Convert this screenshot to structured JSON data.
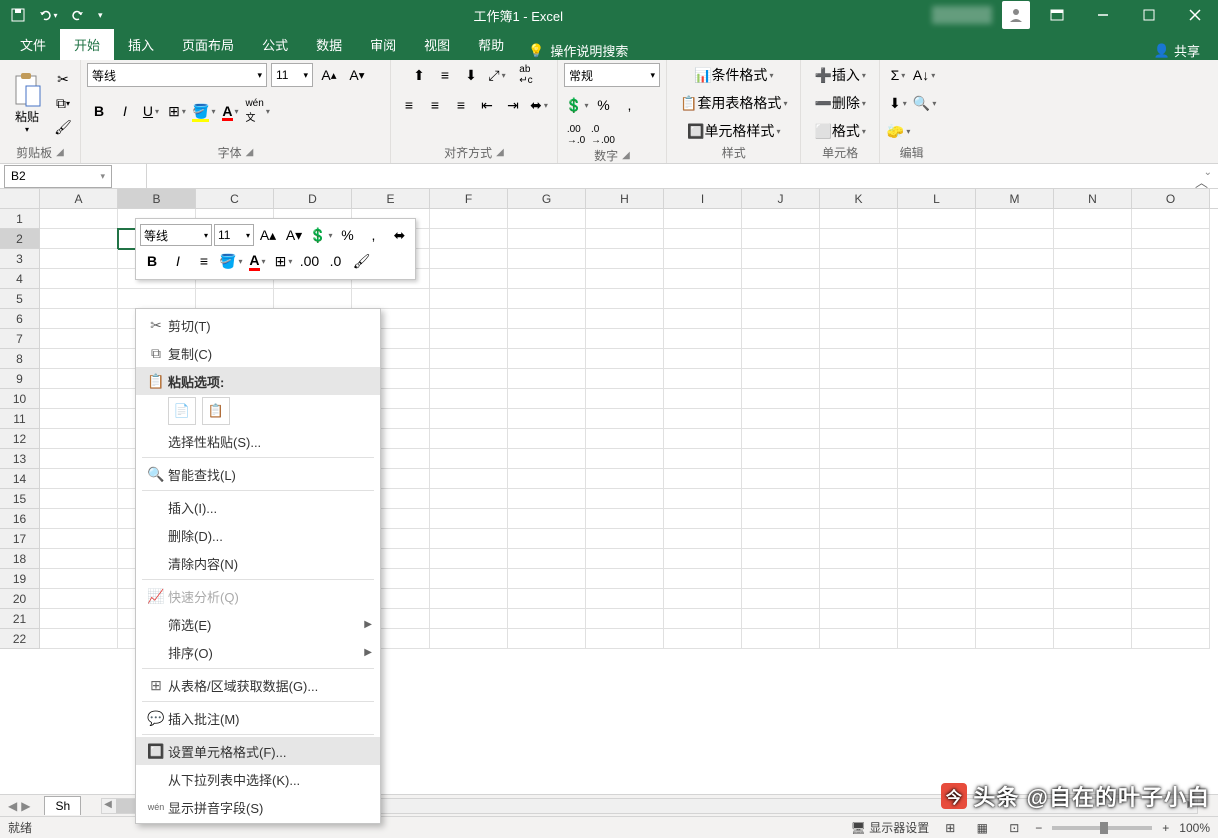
{
  "title": "工作簿1 - Excel",
  "qat": {
    "save": "💾",
    "undo": "↶",
    "redo": "↷"
  },
  "tabs": {
    "file": "文件",
    "home": "开始",
    "insert": "插入",
    "layout": "页面布局",
    "formulas": "公式",
    "data": "数据",
    "review": "审阅",
    "view": "视图",
    "help": "帮助",
    "tellme": "操作说明搜索",
    "share": "共享"
  },
  "ribbon": {
    "clipboard": {
      "label": "剪贴板",
      "paste": "粘贴"
    },
    "font": {
      "label": "字体",
      "name": "等线",
      "size": "11"
    },
    "align": {
      "label": "对齐方式"
    },
    "number": {
      "label": "数字",
      "format": "常规"
    },
    "styles": {
      "label": "样式",
      "cond": "条件格式",
      "table": "套用表格格式",
      "cell": "单元格样式"
    },
    "cells": {
      "label": "单元格",
      "insert": "插入",
      "delete": "删除",
      "format": "格式"
    },
    "editing": {
      "label": "编辑"
    }
  },
  "namebox": "B2",
  "mini": {
    "font": "等线",
    "size": "11"
  },
  "columns": [
    "A",
    "B",
    "C",
    "D",
    "E",
    "F",
    "G",
    "H",
    "I",
    "J",
    "K",
    "L",
    "M",
    "N",
    "O"
  ],
  "rows": [
    1,
    2,
    3,
    4,
    5,
    6,
    7,
    8,
    9,
    10,
    11,
    12,
    13,
    14,
    15,
    16,
    17,
    18,
    19,
    20,
    21,
    22
  ],
  "selectedCell": "B2",
  "contextMenu": {
    "cut": "剪切(T)",
    "copy": "复制(C)",
    "pasteOptions": "粘贴选项:",
    "pasteSpecial": "选择性粘贴(S)...",
    "smartLookup": "智能查找(L)",
    "insert": "插入(I)...",
    "delete": "删除(D)...",
    "clear": "清除内容(N)",
    "quickAnalysis": "快速分析(Q)",
    "filter": "筛选(E)",
    "sort": "排序(O)",
    "fromTable": "从表格/区域获取数据(G)...",
    "insertComment": "插入批注(M)",
    "formatCells": "设置单元格格式(F)...",
    "pickList": "从下拉列表中选择(K)...",
    "showPhonetic": "显示拼音字段(S)"
  },
  "sheet": "Sh",
  "status": {
    "ready": "就绪",
    "display": "显示器设置",
    "zoom": "100%"
  },
  "watermark": "头条 @自在的叶子小白"
}
